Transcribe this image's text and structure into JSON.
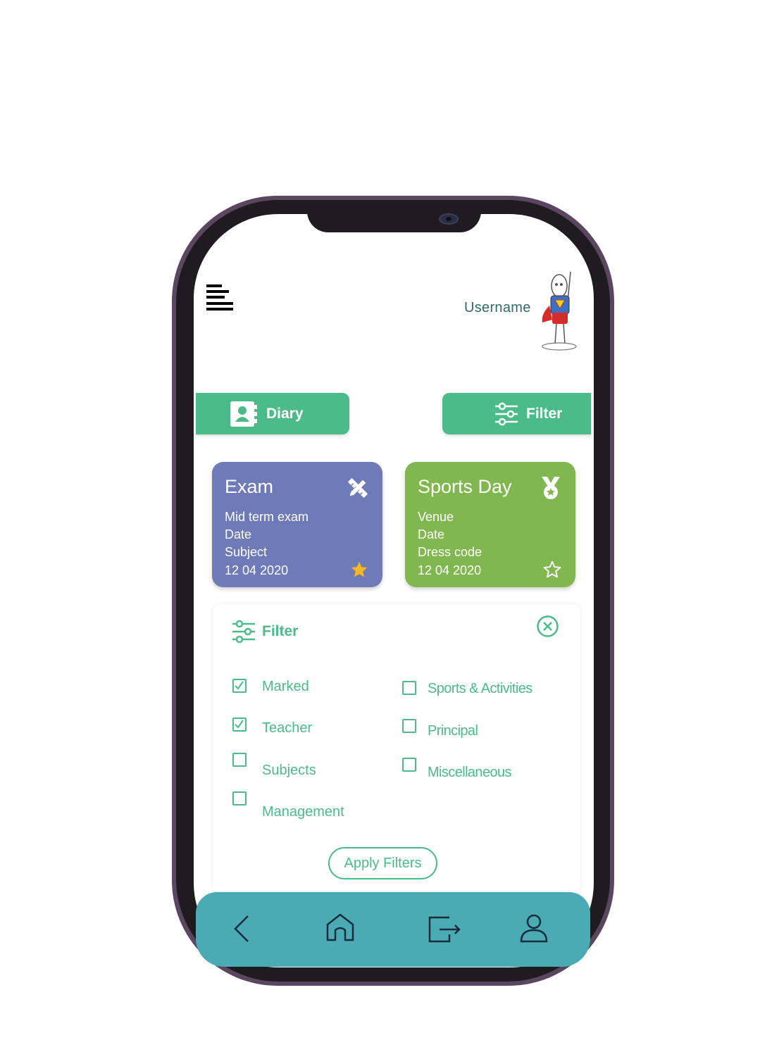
{
  "header": {
    "username": "Username"
  },
  "actions": {
    "diary_label": "Diary",
    "filter_label": "Filter"
  },
  "cards": [
    {
      "title": "Exam",
      "lines": [
        "Mid term exam",
        "Date",
        "Subject",
        "12 04 2020"
      ],
      "icon": "pencil-ruler-icon",
      "starred": true,
      "color": "#6f7ab8"
    },
    {
      "title": "Sports Day",
      "lines": [
        "Venue",
        "Date",
        "Dress code",
        "12 04 2020"
      ],
      "icon": "medal-icon",
      "starred": false,
      "color": "#80b74f"
    }
  ],
  "filter_panel": {
    "title": "Filter",
    "options": [
      {
        "label": "Marked",
        "checked": true
      },
      {
        "label": "Teacher",
        "checked": true
      },
      {
        "label": "Subjects",
        "checked": false
      },
      {
        "label": "Management",
        "checked": false
      },
      {
        "label": "Sports & Activities",
        "checked": false
      },
      {
        "label": "Principal",
        "checked": false
      },
      {
        "label": "Miscellaneous",
        "checked": false
      }
    ],
    "apply_label": "Apply Filters"
  },
  "bottom_nav": {
    "items": [
      "back-icon",
      "home-icon",
      "logout-icon",
      "profile-icon"
    ]
  },
  "colors": {
    "accent": "#4cbb8a",
    "nav": "#4aabb5",
    "exam_card": "#6f7ab8",
    "sports_card": "#80b74f",
    "star": "#f5b820"
  }
}
